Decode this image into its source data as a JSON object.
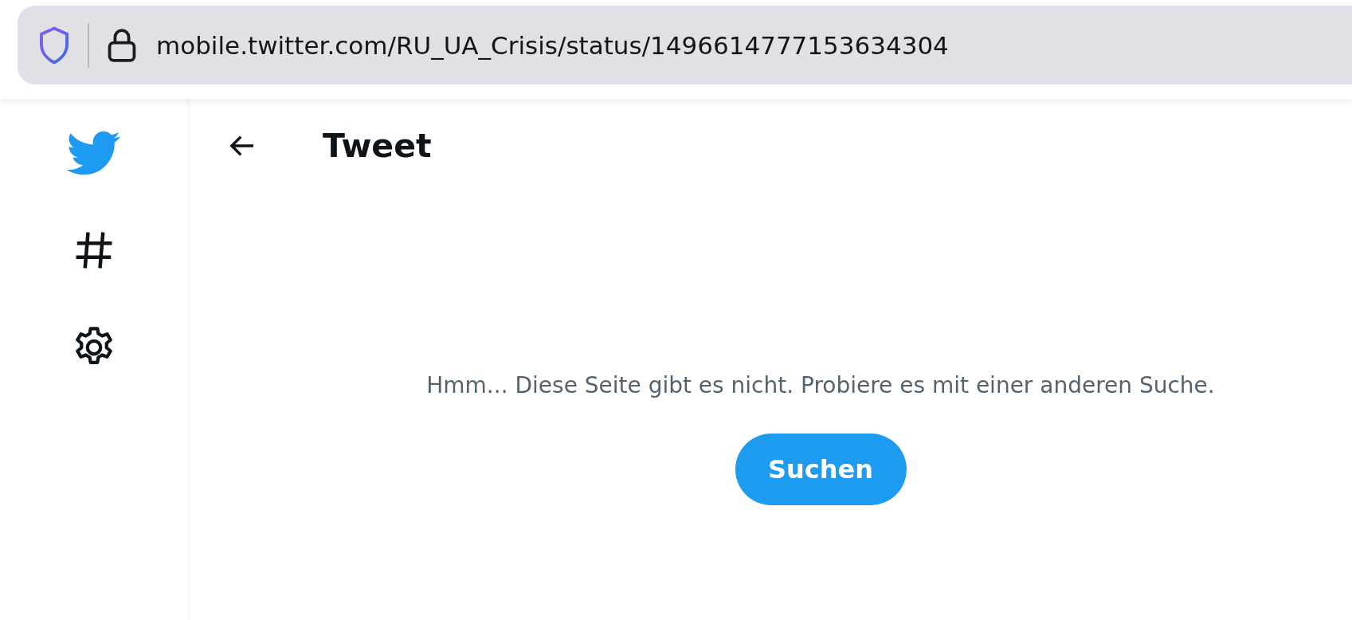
{
  "browser": {
    "url": "mobile.twitter.com/RU_UA_Crisis/status/1496614777153634304"
  },
  "header": {
    "title": "Tweet"
  },
  "message": "Hmm... Diese Seite gibt es nicht. Probiere es mit einer anderen Suche.",
  "button": "Suchen"
}
